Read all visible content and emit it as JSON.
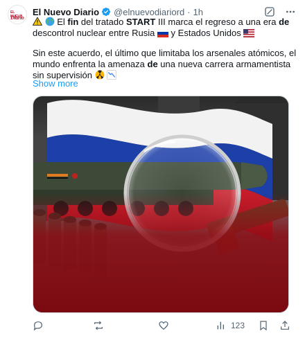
{
  "author": {
    "name": "El Nuevo Diario",
    "handle": "@elnuevodiariord",
    "time": "1h",
    "avatar_logo_top": "EL NUEVO",
    "avatar_logo_bottom": "Diario"
  },
  "post": {
    "line1_a": "El ",
    "line1_b": "fin",
    "line1_c": " del tratado ",
    "line1_d": "START",
    "line1_e": " III marca el regreso a una era ",
    "line1_f": "de",
    "line1_g": " descontrol nuclear entre Rusia ",
    "line1_h": " y Estados Unidos ",
    "line2_a": "Sin este acuerdo, el último que limitaba los arsenales atómicos, el mundo enfrenta la amenaza ",
    "line2_b": "de",
    "line2_c": " una nueva carrera armamentista sin supervisión",
    "show_more": "Show more"
  },
  "actions": {
    "replies": "",
    "reposts": "",
    "likes": "",
    "views": "123"
  },
  "colors": {
    "accent": "#1d9bf0",
    "muted": "#536471",
    "brand_red": "#c8102e"
  },
  "icons": [
    "verified-icon",
    "grok-icon",
    "more-icon",
    "warning-icon",
    "globe-icon",
    "flag-russia-icon",
    "flag-usa-icon",
    "radioactive-icon",
    "chart-down-icon",
    "reply-icon",
    "repost-icon",
    "like-icon",
    "views-icon",
    "bookmark-icon",
    "share-icon"
  ]
}
